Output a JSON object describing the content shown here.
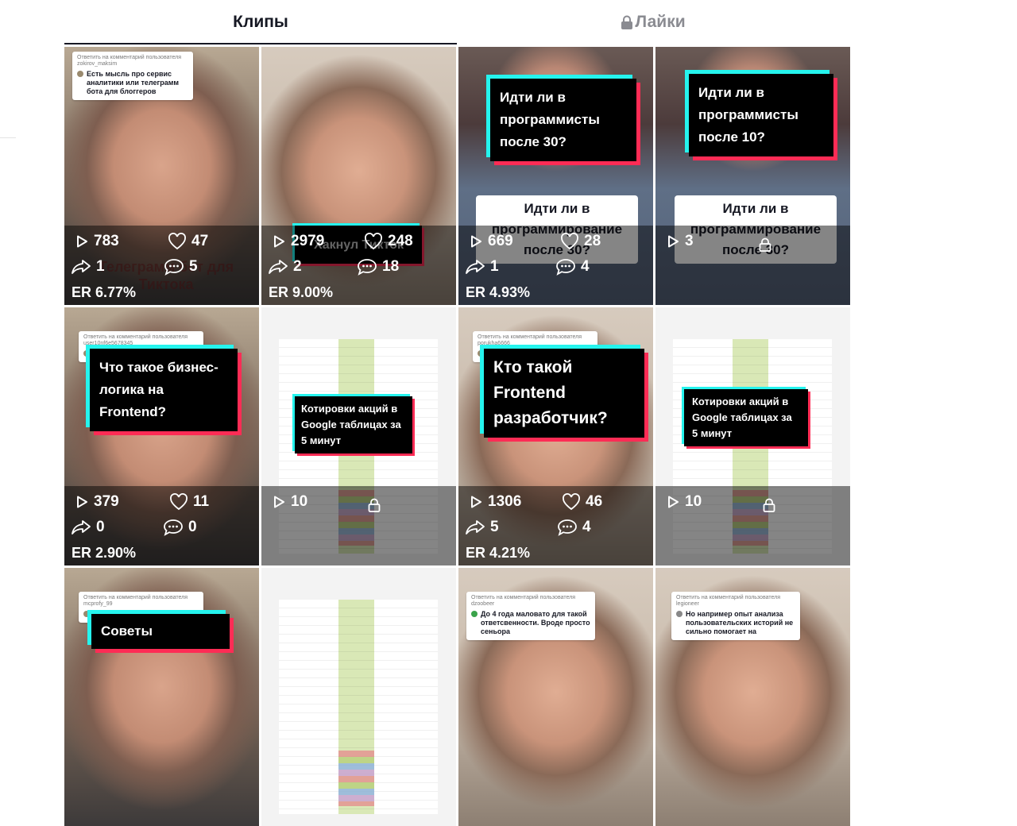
{
  "tabs": [
    {
      "label": "Клипы",
      "active": true
    },
    {
      "label": "Лайки",
      "locked": true
    }
  ],
  "cards": [
    {
      "bubble": {
        "reply": "Ответить на комментарий пользователя zokirov_maksim",
        "text": "Есть мысль про сервис аналитики или телеграмм бота для блоггеров"
      },
      "overlay_caption": "Телеграмм бот для Тиктока",
      "views": "783",
      "likes": "47",
      "shares": "1",
      "comments": "5",
      "er": "ER 6.77%"
    },
    {
      "overlay_caption": "Хакнул Тикток",
      "views": "2979",
      "likes": "248",
      "shares": "2",
      "comments": "18",
      "er": "ER 9.00%"
    },
    {
      "caption": "Идти ли в программисты после 30?",
      "caption2": "Идти ли в программирование после 30?",
      "views": "669",
      "likes": "28",
      "shares": "1",
      "comments": "4",
      "er": "ER 4.93%"
    },
    {
      "caption": "Идти ли в программисты после 10?",
      "caption2": "Идти ли в программирование после 30?",
      "views": "3",
      "locked": true
    },
    {
      "bubble": {
        "reply": "Ответить на комментарий пользователя user10nf6e5678345",
        "text": ""
      },
      "caption": "Что такое бизнес-логика на Frontend?",
      "views": "379",
      "likes": "11",
      "shares": "0",
      "comments": "0",
      "er": "ER 2.90%"
    },
    {
      "caption": "Котировки акций в Google таблицах за 5 минут",
      "views": "10",
      "locked": true
    },
    {
      "bubble": {
        "reply": "Ответить на комментарий пользователя porukha6666",
        "text": ""
      },
      "caption": "Кто такой Frontend разработчик?",
      "views": "1306",
      "likes": "46",
      "shares": "5",
      "comments": "4",
      "er": "ER 4.21%"
    },
    {
      "caption": "Котировки акций в Google таблицах за 5 минут",
      "views": "10",
      "locked": true
    },
    {
      "bubble": {
        "reply": "Ответить на комментарий пользователя mcprofy_99",
        "text": ""
      },
      "caption": "Советы"
    },
    {},
    {
      "bubble": {
        "reply": "Ответить на комментарий пользователя dzoobeer",
        "text": "До 4 года маловато для такой ответсвенности. Вроде просто сеньора"
      }
    },
    {
      "bubble": {
        "reply": "Ответить на комментарий пользователя legioneer",
        "text": "Но например опыт анализа пользовательских историй не сильно помогает на"
      }
    }
  ],
  "colors": {
    "cyan": "#25f4ee",
    "red": "#fe2c55",
    "text": "#161823",
    "muted": "#8a8b91"
  }
}
